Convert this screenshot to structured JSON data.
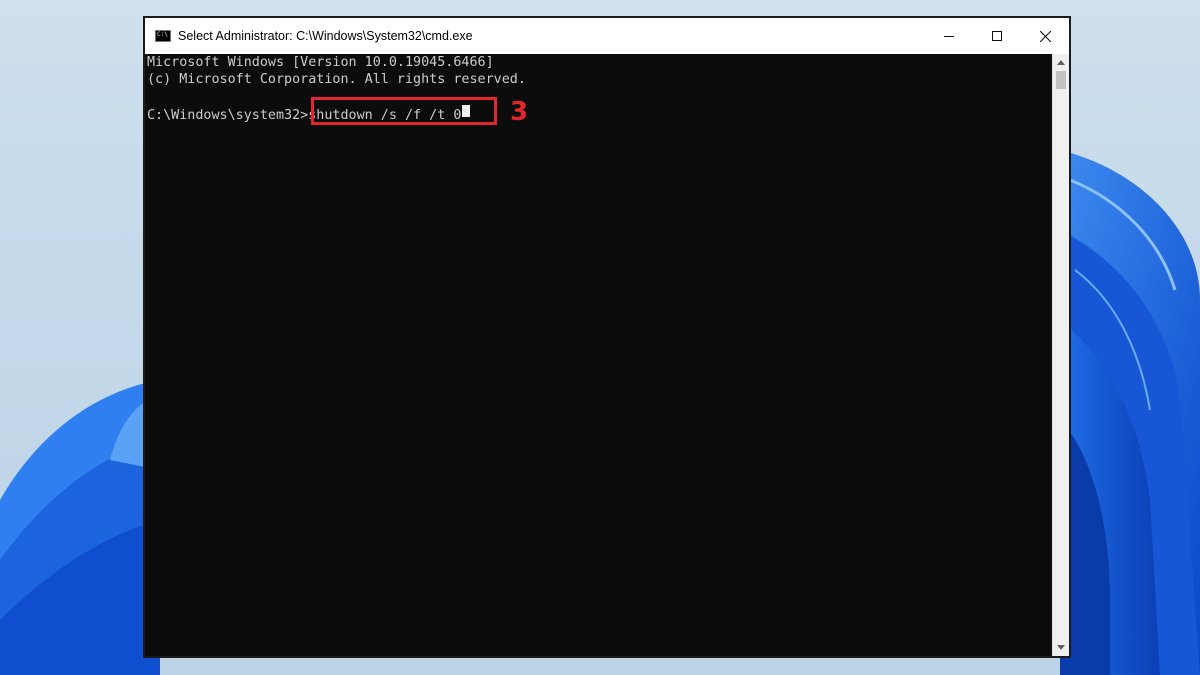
{
  "window": {
    "title": "Select Administrator: C:\\Windows\\System32\\cmd.exe",
    "app_icon": "cmd-icon",
    "controls": [
      "minimize-icon",
      "maximize-icon",
      "close-icon"
    ]
  },
  "console": {
    "lines": [
      "Microsoft Windows [Version 10.0.19045.6466]",
      "(c) Microsoft Corporation. All rights reserved.",
      ""
    ],
    "prompt": "C:\\Windows\\system32>",
    "command": "shutdown /s /f /t 0",
    "background": "#0c0c0c",
    "text_color": "#cccccc"
  },
  "annotation": {
    "step_number": "3",
    "color": "#e2262d"
  },
  "scrollbar": {
    "up_icon": "chevron-up-icon",
    "down_icon": "chevron-down-icon"
  }
}
